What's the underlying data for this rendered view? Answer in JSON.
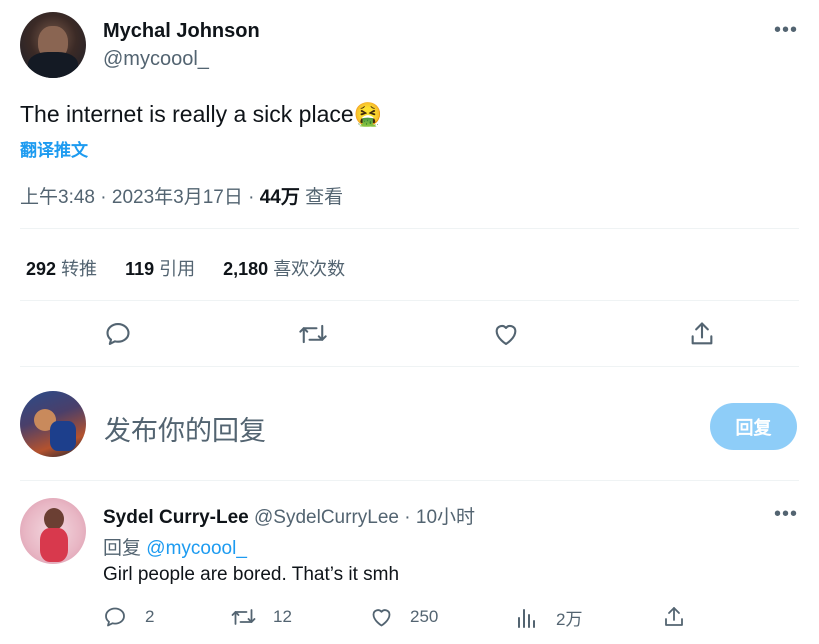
{
  "tweet": {
    "author_name": "Mychal Johnson",
    "author_handle": "@mycoool_",
    "text": "The internet is really a sick place",
    "emoji": "🤮",
    "translate_label": "翻译推文",
    "time": "上午3:48",
    "separator": "·",
    "date": "2023年3月17日",
    "views_count": "44万",
    "views_label": "查看",
    "stats": {
      "retweets_count": "292",
      "retweets_label": "转推",
      "quotes_count": "119",
      "quotes_label": "引用",
      "likes_count": "2,180",
      "likes_label": "喜欢次数"
    }
  },
  "composer": {
    "placeholder": "发布你的回复",
    "reply_button": "回复"
  },
  "reply": {
    "author_name": "Sydel Curry-Lee",
    "author_handle": "@SydelCurryLee",
    "separator": "·",
    "time_ago": "10小时",
    "replying_to_label": "回复",
    "replying_to_handle": "@mycoool_",
    "text": "Girl people are bored. That’s it smh",
    "actions": {
      "replies": "2",
      "retweets": "12",
      "likes": "250",
      "views": "2万"
    }
  },
  "colors": {
    "accent": "#1d9bf0",
    "reply_button_bg": "#8ecdf8",
    "muted_text": "#536471",
    "divider": "#eff3f4"
  },
  "icons": [
    "more-icon",
    "reply-icon",
    "retweet-icon",
    "like-icon",
    "share-icon",
    "views-icon"
  ]
}
